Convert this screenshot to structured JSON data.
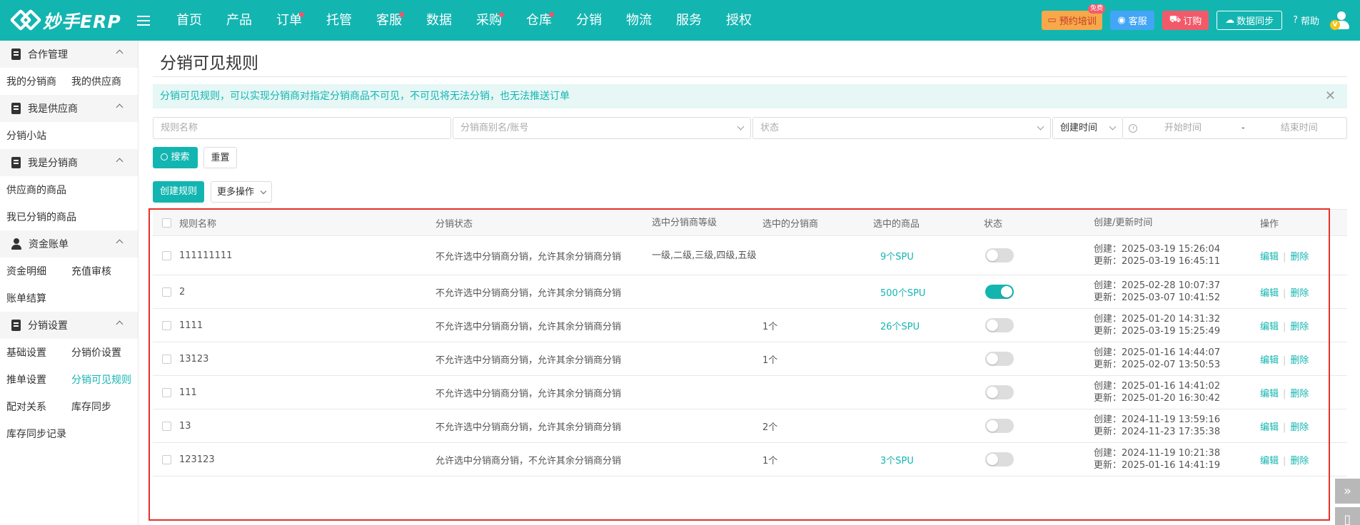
{
  "app": {
    "logo_text": "妙手ERP",
    "nav": [
      {
        "label": "首页",
        "dot": false
      },
      {
        "label": "产品",
        "dot": false
      },
      {
        "label": "订单",
        "dot": true
      },
      {
        "label": "托管",
        "dot": false
      },
      {
        "label": "客服",
        "dot": true
      },
      {
        "label": "数据",
        "dot": false
      },
      {
        "label": "采购",
        "dot": true
      },
      {
        "label": "仓库",
        "dot": true
      },
      {
        "label": "分销",
        "dot": false
      },
      {
        "label": "物流",
        "dot": false
      },
      {
        "label": "服务",
        "dot": false
      },
      {
        "label": "授权",
        "dot": false
      }
    ],
    "actions": {
      "train": "预约培训",
      "train_badge": "免费",
      "kefu": "客服",
      "order": "订购",
      "sync": "数据同步",
      "help": "帮助",
      "vip": "V"
    },
    "colors": {
      "brand": "#13b5b1",
      "dot": "#f2546a",
      "highlight": "#e5302a"
    }
  },
  "sidebar": {
    "groups": [
      {
        "title": "合作管理",
        "icon": "clipboard-icon",
        "rows": [
          [
            "我的分销商",
            "我的供应商"
          ]
        ]
      },
      {
        "title": "我是供应商",
        "icon": "clipboard-icon",
        "rows": [
          [
            "分销小站"
          ]
        ]
      },
      {
        "title": "我是分销商",
        "icon": "clipboard-icon",
        "rows": [
          [
            "供应商的商品"
          ],
          [
            "我已分销的商品"
          ]
        ]
      },
      {
        "title": "资金账单",
        "icon": "user-icon",
        "rows": [
          [
            "资金明细",
            "充值审核"
          ],
          [
            "账单结算"
          ]
        ]
      },
      {
        "title": "分销设置",
        "icon": "clipboard-icon",
        "rows": [
          [
            "基础设置",
            "分销价设置"
          ],
          [
            "推单设置",
            "分销可见规则"
          ],
          [
            "配对关系",
            "库存同步"
          ],
          [
            "库存同步记录"
          ]
        ]
      }
    ],
    "active": "分销可见规则"
  },
  "page": {
    "title": "分销可见规则",
    "alert": "分销可见规则，可以实现分销商对指定分销商品不可见，不可见将无法分销，也无法推送订单",
    "filters": {
      "name_placeholder": "规则名称",
      "dist_placeholder": "分销商别名/账号",
      "status_placeholder": "状态",
      "time_type": "创建时间",
      "start_placeholder": "开始时间",
      "range_sep": "-",
      "end_placeholder": "结束时间"
    },
    "buttons": {
      "search": "搜索",
      "reset": "重置",
      "create": "创建规则",
      "more": "更多操作"
    }
  },
  "table": {
    "columns": [
      "规则名称",
      "分销状态",
      "选中分销商等级",
      "选中的分销商",
      "选中的商品",
      "状态",
      "创建/更新时间",
      "操作"
    ],
    "created_prefix": "创建：",
    "updated_prefix": "更新：",
    "edit_label": "编辑",
    "delete_label": "删除",
    "rows": [
      {
        "name": "111111111",
        "status": "不允许选中分销商分销，允许其余分销商分销",
        "level": "一级,二级,三级,四级,五级",
        "dist": "",
        "goods": "9个SPU",
        "on": false,
        "created": "2025-03-19 15:26:04",
        "updated": "2025-03-19 16:45:11"
      },
      {
        "name": "2",
        "status": "不允许选中分销商分销，允许其余分销商分销",
        "level": "",
        "dist": "",
        "goods": "500个SPU",
        "on": true,
        "created": "2025-02-28 10:07:37",
        "updated": "2025-03-07 10:41:52"
      },
      {
        "name": "1111",
        "status": "不允许选中分销商分销，允许其余分销商分销",
        "level": "",
        "dist": "1个",
        "goods": "26个SPU",
        "on": false,
        "created": "2025-01-20 14:31:32",
        "updated": "2025-03-19 15:25:49"
      },
      {
        "name": "13123",
        "status": "不允许选中分销商分销，允许其余分销商分销",
        "level": "",
        "dist": "1个",
        "goods": "",
        "on": false,
        "created": "2025-01-16 14:44:07",
        "updated": "2025-02-07 13:50:53"
      },
      {
        "name": "111",
        "status": "不允许选中分销商分销，允许其余分销商分销",
        "level": "",
        "dist": "",
        "goods": "",
        "on": false,
        "created": "2025-01-16 14:41:02",
        "updated": "2025-01-20 16:30:42"
      },
      {
        "name": "13",
        "status": "不允许选中分销商分销，允许其余分销商分销",
        "level": "",
        "dist": "2个",
        "goods": "",
        "on": false,
        "created": "2024-11-19 13:59:16",
        "updated": "2024-11-23 17:35:38"
      },
      {
        "name": "123123",
        "status": "允许选中分销商分销，不允许其余分销商分销",
        "level": "",
        "dist": "1个",
        "goods": "3个SPU",
        "on": false,
        "created": "2024-11-19 10:21:38",
        "updated": "2025-01-16 14:41:19"
      }
    ]
  }
}
